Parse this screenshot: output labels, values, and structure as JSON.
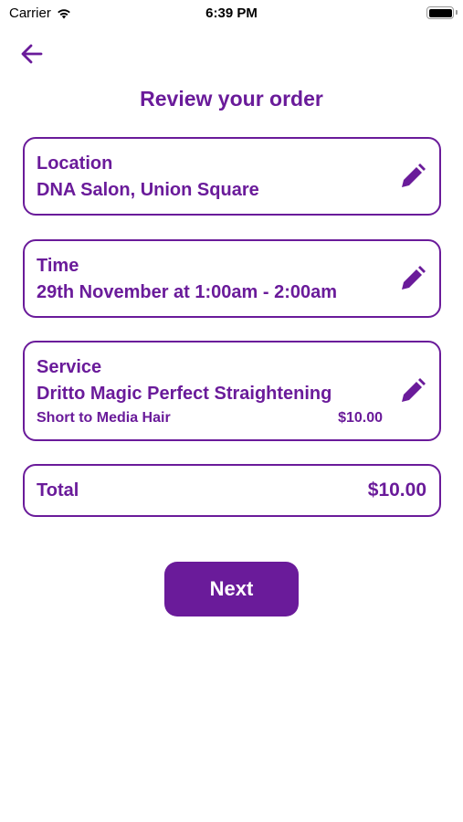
{
  "status_bar": {
    "carrier": "Carrier",
    "time": "6:39 PM"
  },
  "header": {
    "title": "Review your order"
  },
  "location": {
    "label": "Location",
    "value": "DNA Salon, Union Square"
  },
  "time": {
    "label": "Time",
    "value": "29th November at 1:00am - 2:00am"
  },
  "service": {
    "label": "Service",
    "name": "Dritto Magic Perfect Straightening",
    "option": "Short to Media Hair",
    "price": "$10.00"
  },
  "total": {
    "label": "Total",
    "value": "$10.00"
  },
  "actions": {
    "next_label": "Next"
  },
  "colors": {
    "accent": "#6a1b9a",
    "background": "#ffffff"
  },
  "icons": {
    "back": "arrow-left-icon",
    "edit": "pencil-icon"
  }
}
